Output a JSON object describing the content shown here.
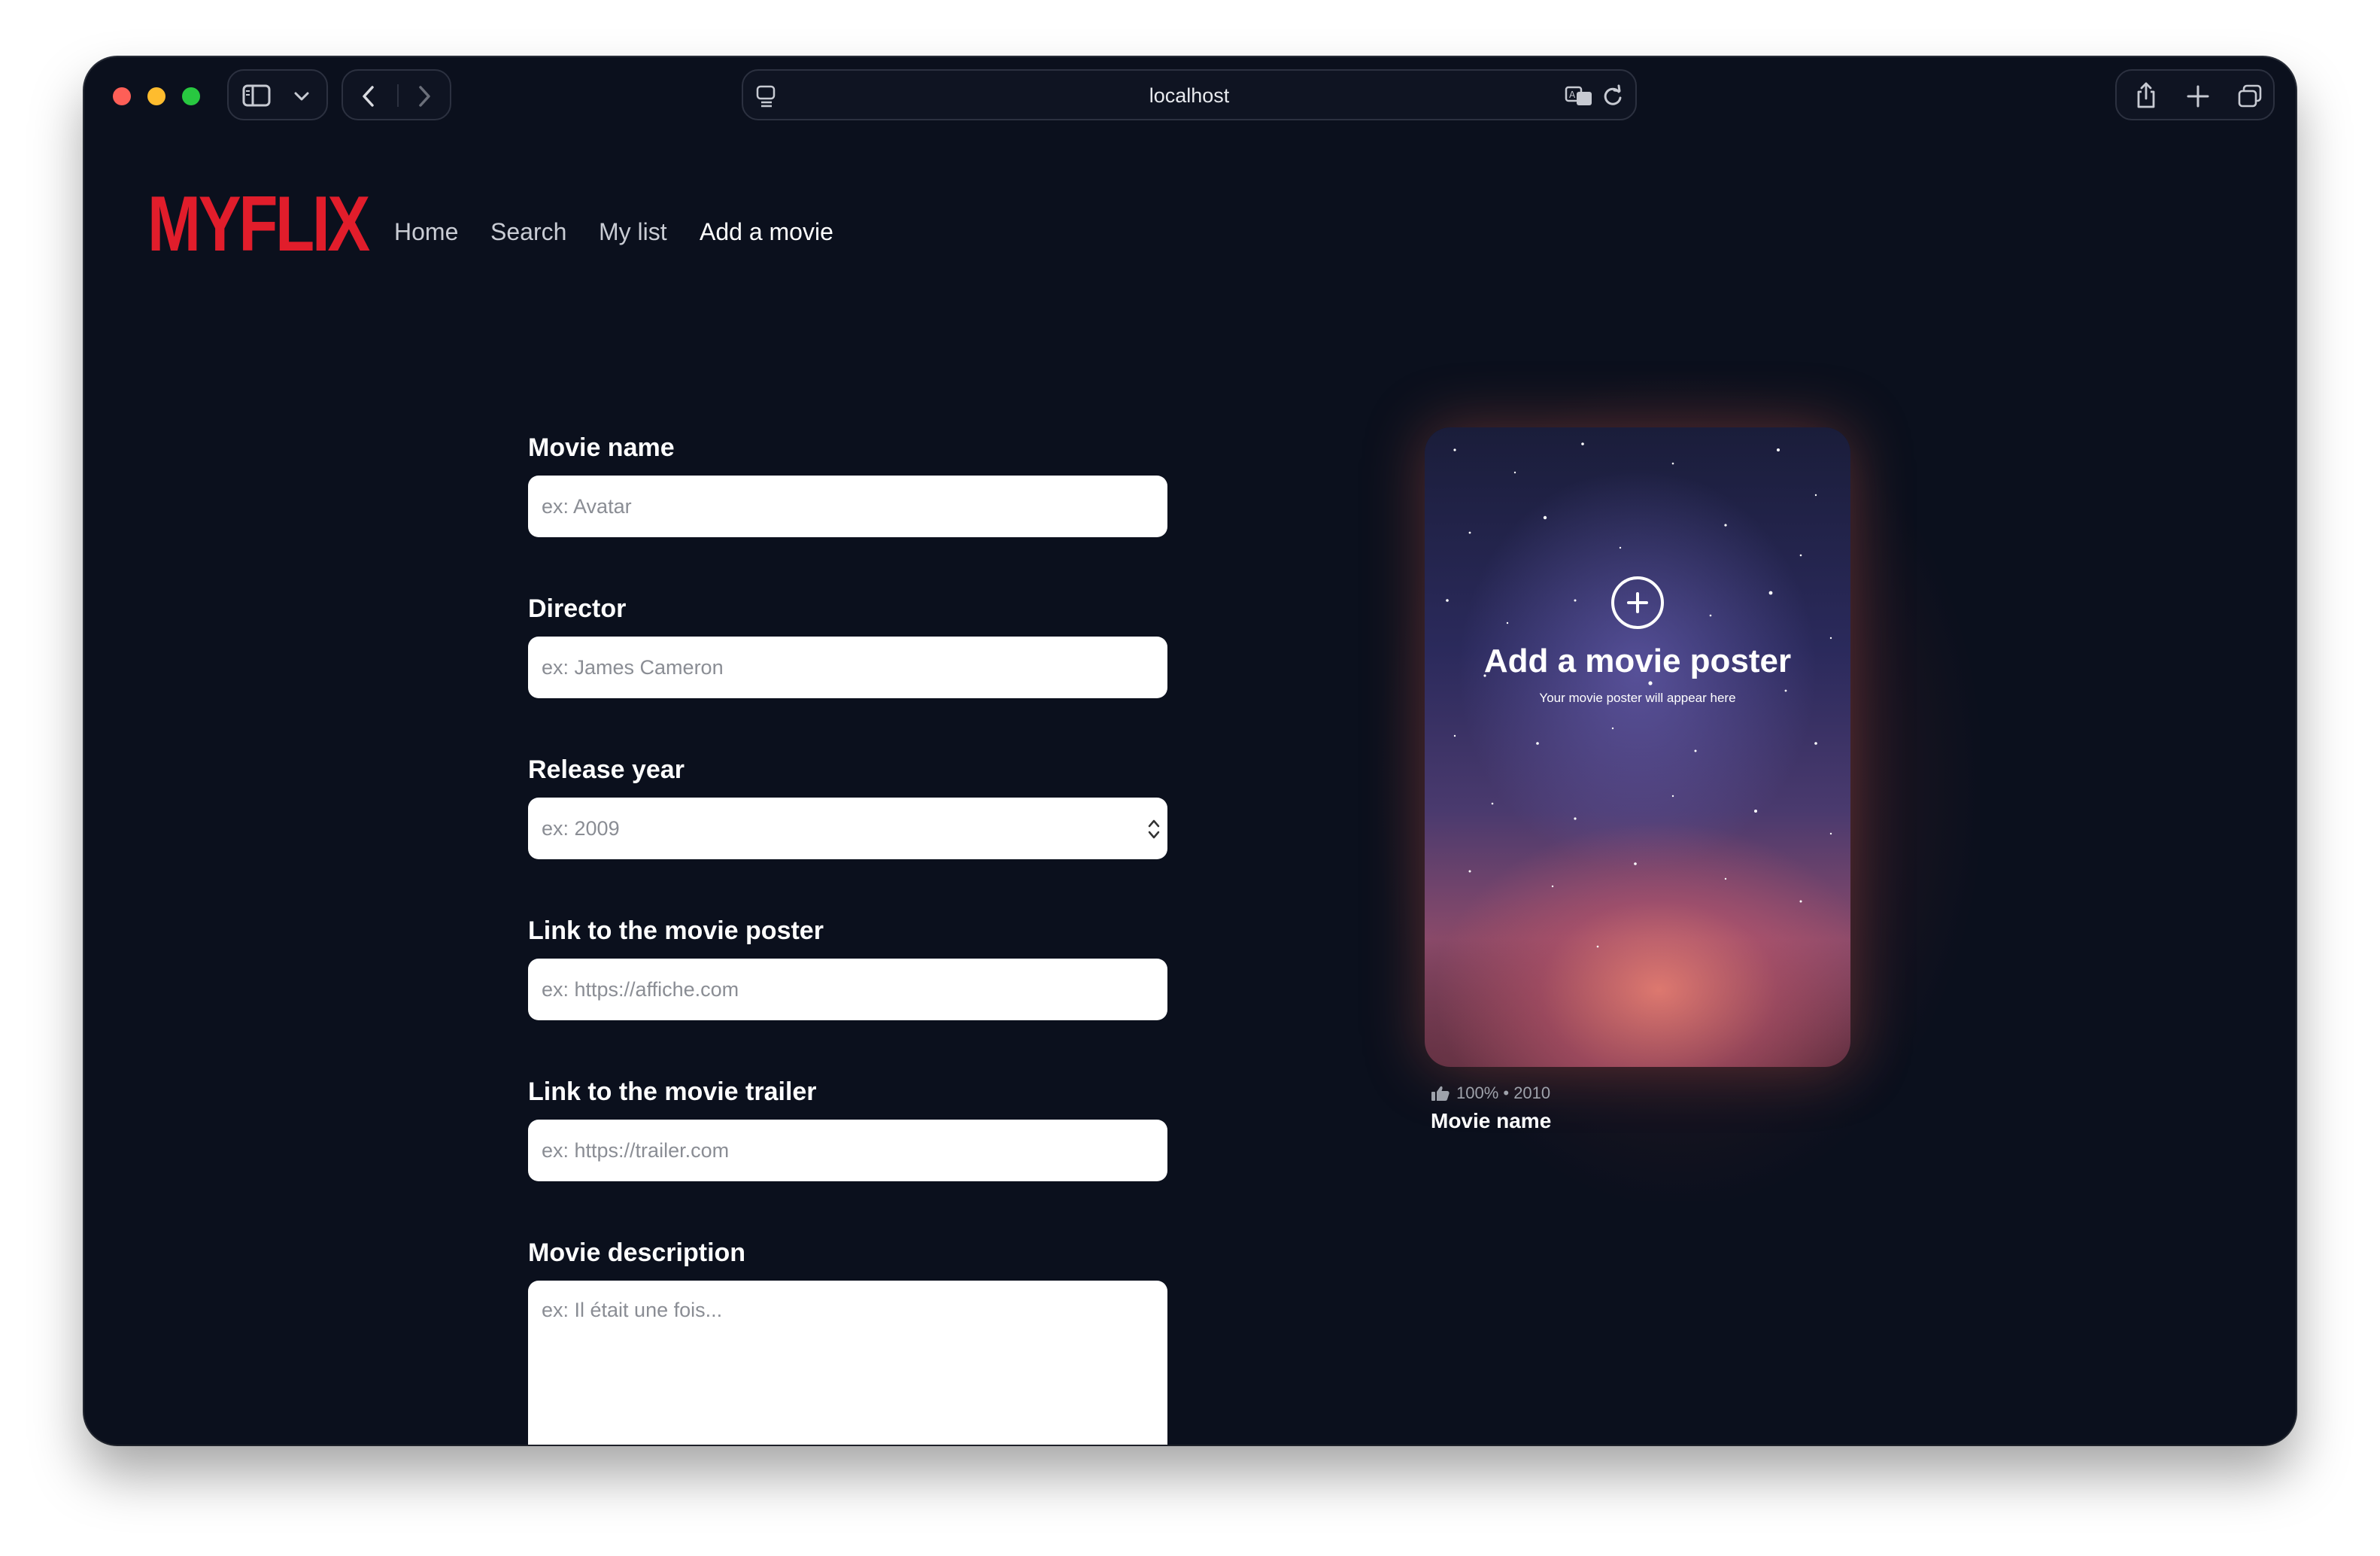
{
  "browser": {
    "url": "localhost",
    "icons": {
      "sidebar": "sidebar-icon",
      "chevron": "chevron-down-icon",
      "back": "back-icon",
      "forward": "forward-icon",
      "reader": "reader-icon",
      "translate": "translate-icon",
      "reload": "reload-icon",
      "share": "share-icon",
      "new_tab": "plus-icon",
      "tabs": "tabs-overview-icon"
    }
  },
  "site": {
    "logo": "MYFLIX",
    "brand_color": "#e11d2b",
    "nav": [
      {
        "label": "Home"
      },
      {
        "label": "Search"
      },
      {
        "label": "My list"
      },
      {
        "label": "Add a movie"
      }
    ]
  },
  "form": {
    "movie_name": {
      "label": "Movie name",
      "placeholder": "ex: Avatar",
      "value": ""
    },
    "director": {
      "label": "Director",
      "placeholder": "ex: James Cameron",
      "value": ""
    },
    "release_year": {
      "label": "Release year",
      "placeholder": "ex: 2009",
      "value": ""
    },
    "poster_link": {
      "label": "Link to the movie poster",
      "placeholder": "ex: https://affiche.com",
      "value": ""
    },
    "trailer_link": {
      "label": "Link to the movie trailer",
      "placeholder": "ex: https://trailer.com",
      "value": ""
    },
    "description": {
      "label": "Movie description",
      "placeholder": "ex: Il était une fois...",
      "value": ""
    }
  },
  "preview": {
    "title": "Add a movie poster",
    "subtitle": "Your movie poster will appear here",
    "meta": "100% • 2010",
    "movie_name": "Movie name"
  }
}
